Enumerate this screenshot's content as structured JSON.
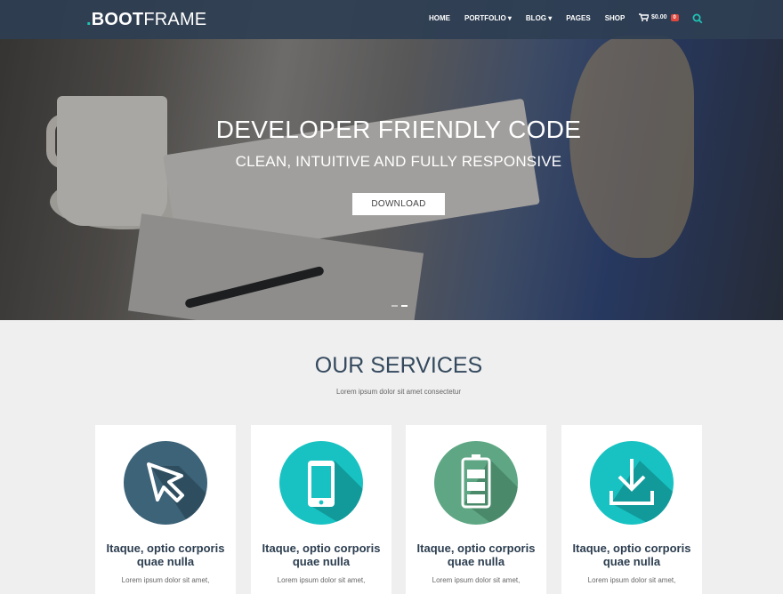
{
  "brand": {
    "prefix": ".",
    "bold": "BOOT",
    "rest": "FRAME"
  },
  "nav": {
    "items": [
      "HOME",
      "PORTFOLIO ▾",
      "BLOG ▾",
      "PAGES",
      "SHOP"
    ],
    "cart_amount": "$0.00",
    "cart_count": "0"
  },
  "hero": {
    "title": "DEVELOPER FRIENDLY CODE",
    "subtitle": "CLEAN, INTUITIVE AND FULLY RESPONSIVE",
    "button": "DOWNLOAD"
  },
  "services": {
    "title": "OUR SERVICES",
    "subtitle": "Lorem ipsum dolor sit amet consectetur",
    "cards": [
      {
        "icon": "cursor-icon",
        "color": "#3d6378",
        "title_line1": "Itaque, optio corporis",
        "title_line2": "quae nulla",
        "text": "Lorem ipsum dolor sit amet,"
      },
      {
        "icon": "mobile-icon",
        "color": "#18c2c2",
        "title_line1": "Itaque, optio corporis",
        "title_line2": "quae nulla",
        "text": "Lorem ipsum dolor sit amet,"
      },
      {
        "icon": "battery-icon",
        "color": "#5fa784",
        "title_line1": "Itaque, optio corporis",
        "title_line2": "quae nulla",
        "text": "Lorem ipsum dolor sit amet,"
      },
      {
        "icon": "download-icon",
        "color": "#18c2c2",
        "title_line1": "Itaque, optio corporis",
        "title_line2": "quae nulla",
        "text": "Lorem ipsum dolor sit amet,"
      }
    ]
  },
  "colors": {
    "accent": "#1fc3b4",
    "badge": "#e0473e",
    "nav_bg": "#2e3e52"
  }
}
